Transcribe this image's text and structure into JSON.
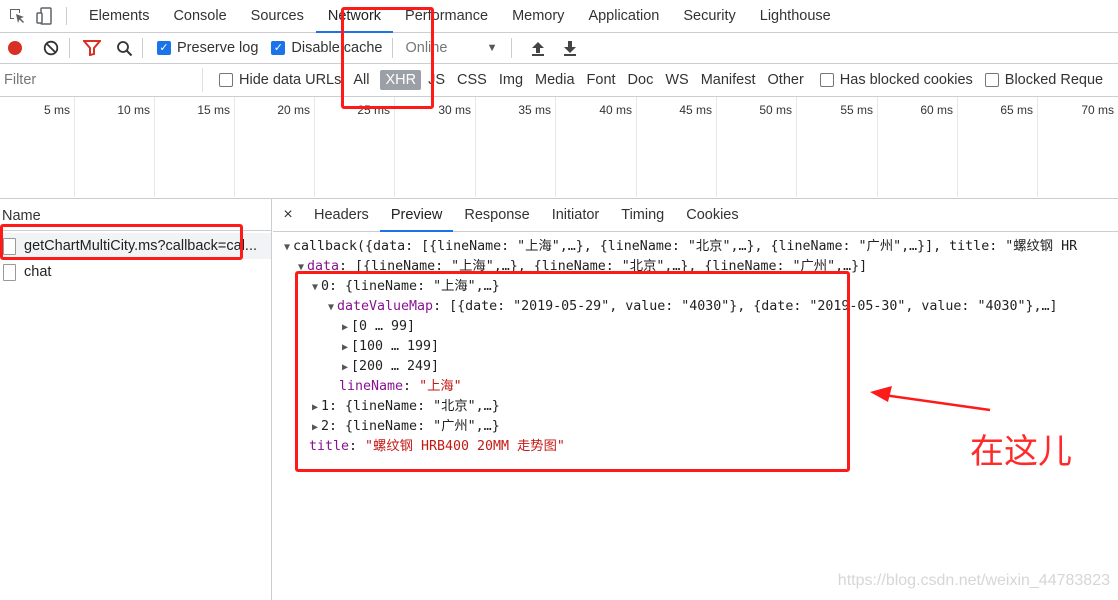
{
  "devtools": {
    "tabs": [
      "Elements",
      "Console",
      "Sources",
      "Network",
      "Performance",
      "Memory",
      "Application",
      "Security",
      "Lighthouse"
    ]
  },
  "toolbar": {
    "preserve_log": "Preserve log",
    "disable_cache": "Disable cache",
    "throttle": "Online"
  },
  "filter": {
    "placeholder": "Filter",
    "hide_data_urls": "Hide data URLs",
    "types": [
      "All",
      "XHR",
      "JS",
      "CSS",
      "Img",
      "Media",
      "Font",
      "Doc",
      "WS",
      "Manifest",
      "Other"
    ],
    "has_blocked_cookies": "Has blocked cookies",
    "blocked_requests": "Blocked Reque"
  },
  "timeline": {
    "ticks": [
      "5 ms",
      "10 ms",
      "15 ms",
      "20 ms",
      "25 ms",
      "30 ms",
      "35 ms",
      "40 ms",
      "45 ms",
      "50 ms",
      "55 ms",
      "60 ms",
      "65 ms",
      "70 ms"
    ]
  },
  "requests": {
    "header": "Name",
    "items": [
      "getChartMultiCity.ms?callback=cal...",
      "chat"
    ]
  },
  "detail": {
    "tabs": [
      "Headers",
      "Preview",
      "Response",
      "Initiator",
      "Timing",
      "Cookies"
    ],
    "close": "×"
  },
  "preview": {
    "l1": "callback({data: [{lineName: \"上海\",…}, {lineName: \"北京\",…}, {lineName: \"广州\",…}], title: \"螺纹钢 HR",
    "l2_key": "data",
    "l2_val": ": [{lineName: \"上海\",…}, {lineName: \"北京\",…}, {lineName: \"广州\",…}]",
    "l3": "0: {lineName: \"上海\",…}",
    "l4_key": "dateValueMap",
    "l4_val": ": [{date: \"2019-05-29\", value: \"4030\"}, {date: \"2019-05-30\", value: \"4030\"},…]",
    "l5": "[0 … 99]",
    "l6": "[100 … 199]",
    "l7": "[200 … 249]",
    "l8_key": "lineName",
    "l8_val": "\"上海\"",
    "l9": "1: {lineName: \"北京\",…}",
    "l10": "2: {lineName: \"广州\",…}",
    "l11_key": "title",
    "l11_val": "\"螺纹钢 HRB400 20MM 走势图\""
  },
  "annotation": "在这儿",
  "watermark": "https://blog.csdn.net/weixin_44783823",
  "colors": {
    "highlight": "#ff1a1a",
    "accent": "#1a73e8",
    "record": "#d93025",
    "filter_icon": "#d93025"
  }
}
